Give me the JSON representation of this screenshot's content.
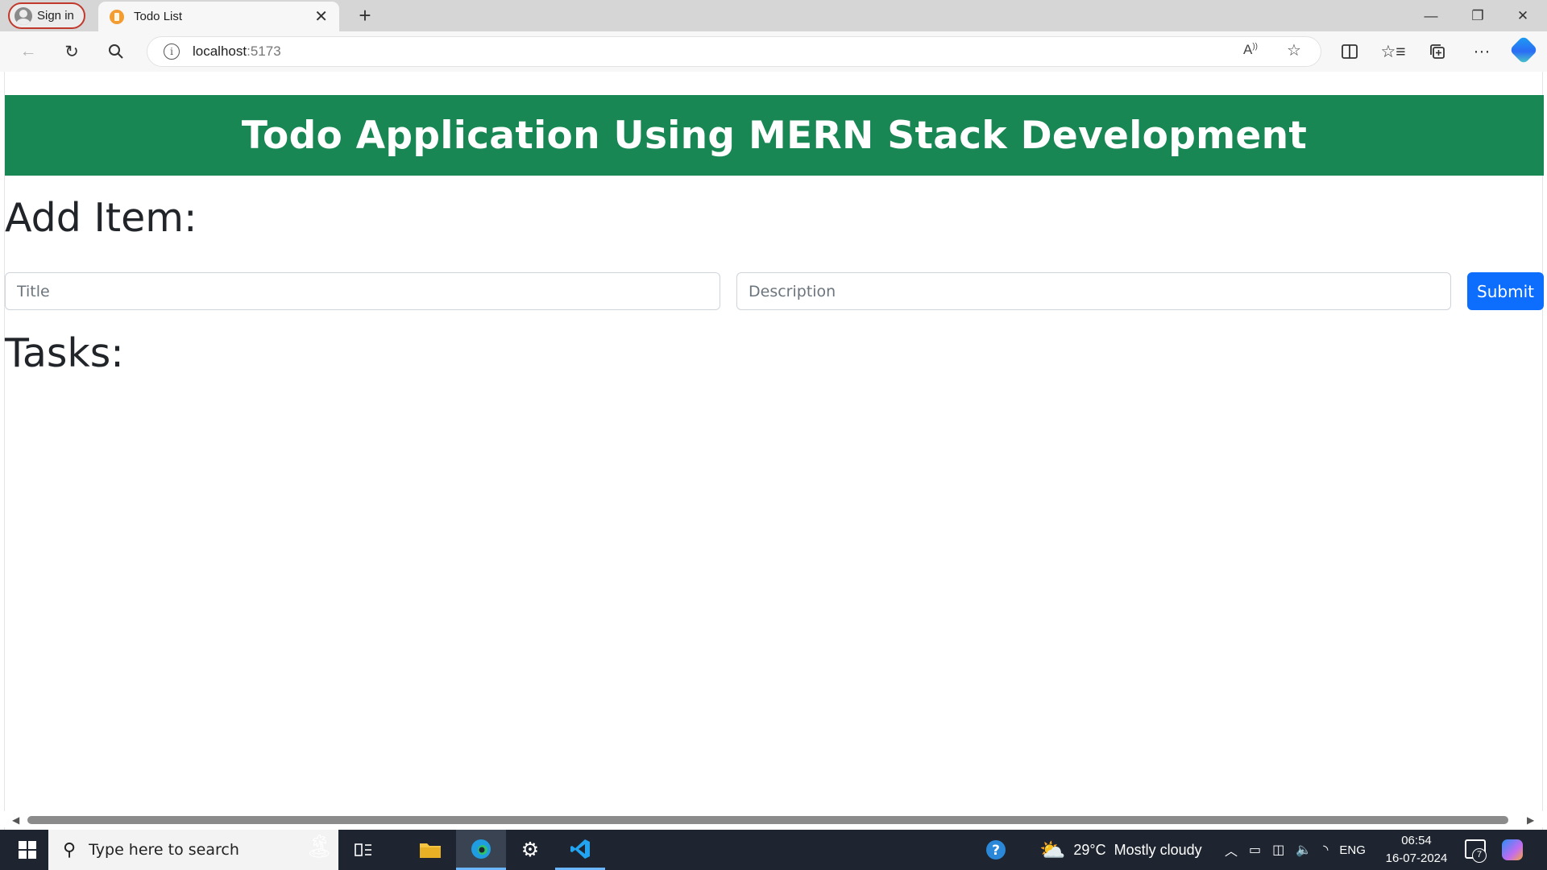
{
  "browser": {
    "signin_label": "Sign in",
    "tab_title": "Todo List",
    "tab_close": "✕",
    "new_tab": "+",
    "url_host": "localhost",
    "url_port": ":5173",
    "icons": [
      "back-icon",
      "refresh-icon",
      "search-icon",
      "read-aloud-icon",
      "favorite-star-icon",
      "split-screen-icon",
      "favorites-icon",
      "collections-icon",
      "more-icon",
      "copilot-icon"
    ]
  },
  "window_controls": {
    "minimize": "—",
    "restore": "❐",
    "close": "✕"
  },
  "app": {
    "header_title": "Todo Application Using MERN Stack Development",
    "add_heading": "Add Item:",
    "title_placeholder": "Title",
    "description_placeholder": "Description",
    "submit_label": "Submit",
    "tasks_heading": "Tasks:",
    "accent_color": "#198754",
    "button_color": "#0d6efd"
  },
  "taskbar": {
    "search_placeholder": "Type here to search",
    "weather_temp": "29°C",
    "weather_text": "Mostly cloudy",
    "language": "ENG",
    "time": "06:54",
    "date": "16-07-2024",
    "notification_count": "7"
  }
}
